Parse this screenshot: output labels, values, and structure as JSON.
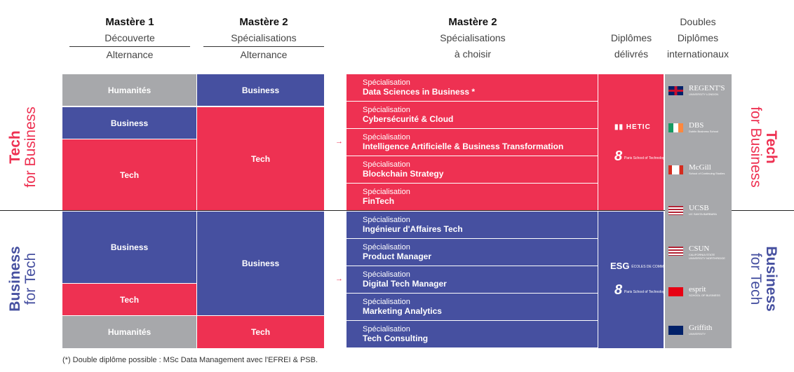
{
  "headers": {
    "m1": {
      "title": "Mastère 1",
      "line1": "Découverte",
      "line2": "Alternance"
    },
    "m2": {
      "title": "Mastère 2",
      "line1": "Spécialisations",
      "line2": "Alternance"
    },
    "m2b": {
      "title": "Mastère 2",
      "line1": "Spécialisations",
      "line2": "à choisir"
    },
    "diplomas": {
      "line1": "Diplômes",
      "line2": "délivrés"
    },
    "doubles": {
      "line1": "Doubles",
      "line2": "Diplômes",
      "line3": "internationaux"
    }
  },
  "tracks": {
    "tech": {
      "bold": "Tech",
      "light": "for Business"
    },
    "business": {
      "bold": "Business",
      "light": "for Tech"
    }
  },
  "m1": [
    "Humanités",
    "Business",
    "Tech",
    "Business",
    "Tech",
    "Humanités"
  ],
  "m2": [
    "Business",
    "Tech",
    "Business",
    "Tech"
  ],
  "arrow": "→",
  "spec_label": "Spécialisation",
  "specs": [
    "Data Sciences in Business *",
    "Cybersécurité & Cloud",
    "Intelligence Artificielle & Business Transformation",
    "Blockchain Strategy",
    "FinTech",
    "Ingénieur d'Affaires Tech",
    "Product Manager",
    "Digital Tech Manager",
    "Marketing Analytics",
    "Tech Consulting"
  ],
  "logos": {
    "hetic": "HETIC",
    "psb": "8",
    "psb_text": "Paris School of Technology & Business",
    "esg": "ESG",
    "esg_text": "ÉCOLES DE COMMERCE"
  },
  "partners": [
    {
      "flag": "uk",
      "name": "REGENT'S",
      "sub": "UNIVERSITY LONDON"
    },
    {
      "flag": "ireland",
      "name": "DBS",
      "sub": "Dublin Business School"
    },
    {
      "flag": "canada",
      "name": "McGill",
      "sub": "School of Continuing Studies"
    },
    {
      "flag": "usa",
      "name": "UCSB",
      "sub": "UC SANTA BARBARA"
    },
    {
      "flag": "usa",
      "name": "CSUN",
      "sub": "CALIFORNIA STATE UNIVERSITY NORTHRIDGE"
    },
    {
      "flag": "tunisia",
      "name": "esprit",
      "sub": "SCHOOL OF BUSINESS"
    },
    {
      "flag": "australia",
      "name": "Griffith",
      "sub": "UNIVERSITY"
    }
  ],
  "footnote": "(*) Double diplôme possible : MSc Data Management avec l'EFREI & PSB.",
  "colors": {
    "tech": "#ee3152",
    "business": "#4650a0",
    "humanites": "#a7a8ab"
  }
}
